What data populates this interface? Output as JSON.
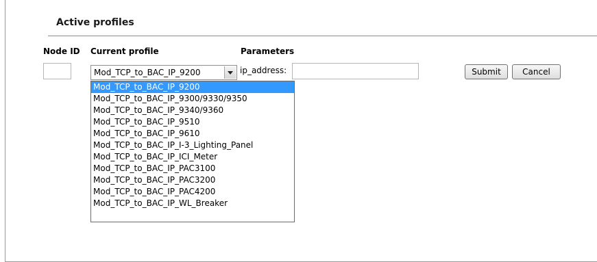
{
  "section_title": "Active profiles",
  "columns": {
    "node_id": "Node ID",
    "current_profile": "Current profile",
    "parameters": "Parameters"
  },
  "node_id_value": "",
  "profile_select": {
    "selected": "Mod_TCP_to_BAC_IP_9200",
    "options": [
      "Mod_TCP_to_BAC_IP_9200",
      "Mod_TCP_to_BAC_IP_9300/9330/9350",
      "Mod_TCP_to_BAC_IP_9340/9360",
      "Mod_TCP_to_BAC_IP_9510",
      "Mod_TCP_to_BAC_IP_9610",
      "Mod_TCP_to_BAC_IP_I-3_Lighting_Panel",
      "Mod_TCP_to_BAC_IP_ICI_Meter",
      "Mod_TCP_to_BAC_IP_PAC3100",
      "Mod_TCP_to_BAC_IP_PAC3200",
      "Mod_TCP_to_BAC_IP_PAC4200",
      "Mod_TCP_to_BAC_IP_WL_Breaker"
    ]
  },
  "parameter": {
    "label": "ip_address:",
    "value": ""
  },
  "buttons": {
    "submit": "Submit",
    "cancel": "Cancel"
  },
  "colors": {
    "selection": "#3399ff",
    "rule": "#8a8a8a"
  }
}
